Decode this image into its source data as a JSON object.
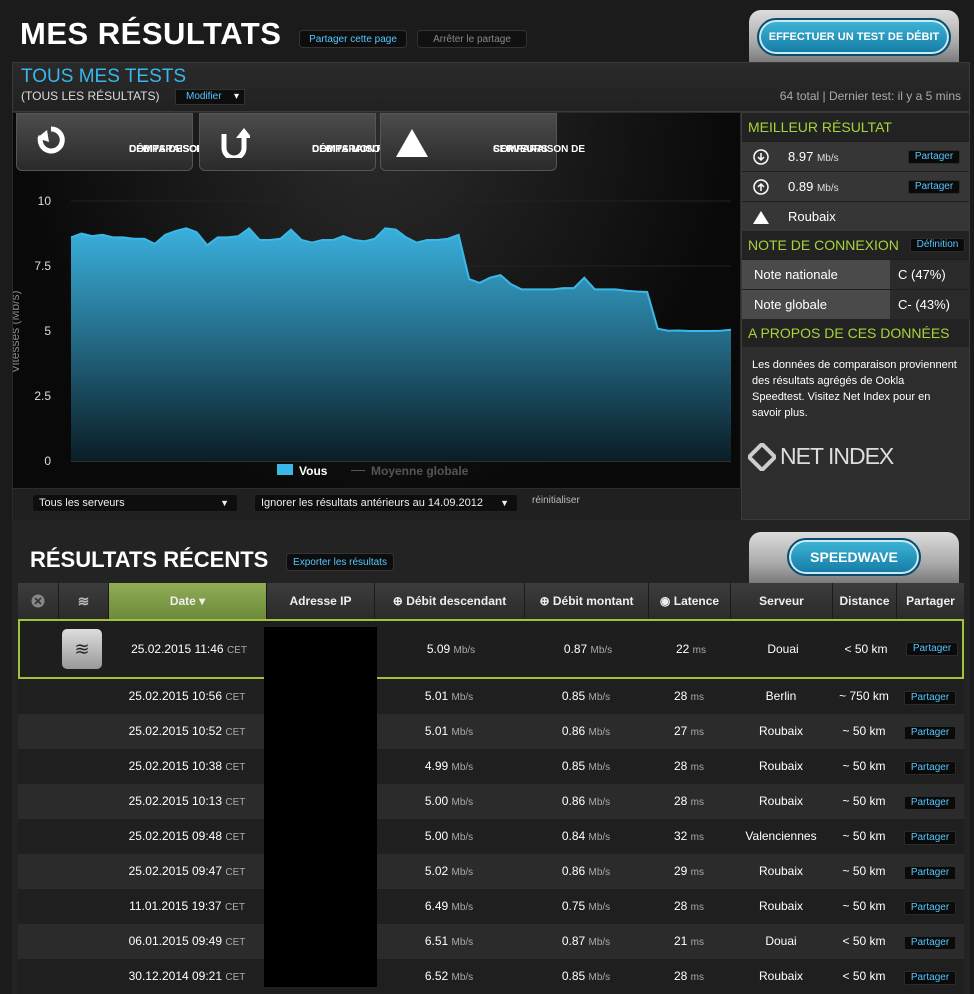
{
  "header": {
    "title": "MES RÉSULTATS",
    "share_page": "Partager cette page",
    "stop_share": "Arrêter le partage",
    "test_button": "EFFECTUER UN TEST DE DÉBIT"
  },
  "panel": {
    "title": "TOUS MES TESTS",
    "subtitle": "(TOUS LES RÉSULTATS)",
    "modify": "Modifier",
    "summary": "64 total | Dernier test: il y a 5 mins"
  },
  "chart_buttons": [
    {
      "line1": "COMPARAISON DE",
      "line2": "DÉBITS DESCENDANTS",
      "icon": "download-arrow-icon"
    },
    {
      "line1": "COMPARAISON DE",
      "line2": "DÉBITS MONTANTS",
      "icon": "upload-arrow-icon"
    },
    {
      "line1": "COMPARAISON DE",
      "line2": "SERVEURS",
      "icon": "triangle-icon"
    }
  ],
  "chart_data": {
    "type": "area",
    "ylabel": "Vitesses (Mb/s)",
    "ylim": [
      0,
      10
    ],
    "yticks": [
      "10",
      "7.5",
      "5",
      "2.5",
      "0"
    ],
    "series": [
      {
        "name": "Vous",
        "color": "#3ab8e8",
        "values": [
          8.6,
          8.75,
          8.65,
          8.7,
          8.6,
          8.6,
          8.55,
          8.55,
          8.35,
          8.7,
          8.85,
          8.95,
          8.8,
          8.3,
          8.6,
          8.6,
          8.65,
          8.95,
          8.5,
          8.5,
          8.55,
          8.9,
          8.5,
          8.4,
          8.5,
          8.5,
          8.65,
          8.5,
          8.45,
          8.55,
          8.95,
          8.9,
          8.6,
          8.4,
          8.5,
          8.5,
          8.55,
          8.7,
          7.0,
          6.85,
          7.05,
          7.15,
          6.8,
          6.6,
          6.6,
          6.6,
          6.6,
          6.65,
          6.65,
          7.05,
          6.6,
          6.6,
          6.6,
          6.55,
          6.52,
          6.5,
          5.09,
          5.01,
          5.02,
          5.0,
          5.0,
          5.0,
          5.01,
          5.05
        ]
      },
      {
        "name": "Moyenne globale",
        "color": "#555"
      }
    ]
  },
  "filters": {
    "servers": "Tous les serveurs",
    "ignore": "Ignorer les résultats antérieurs au 14.09.2012",
    "reset": "réinitialiser"
  },
  "side": {
    "best_title": "MEILLEUR RÉSULTAT",
    "best": [
      {
        "value": "8.97",
        "unit": "Mb/s",
        "share": "Partager",
        "icon": "download-circle-icon"
      },
      {
        "value": "0.89",
        "unit": "Mb/s",
        "share": "Partager",
        "icon": "upload-circle-icon"
      },
      {
        "value": "Roubaix",
        "icon": "triangle-icon"
      }
    ],
    "note_title": "NOTE DE CONNEXION",
    "definition": "Définition",
    "notes": [
      {
        "label": "Note nationale",
        "value": "C (47%)"
      },
      {
        "label": "Note globale",
        "value": "C- (43%)"
      }
    ],
    "about_title": "A PROPOS DE CES DONNÉES",
    "about_text": "Les données de comparaison proviennent des résultats agrégés de Ookla Speedtest. Visitez Net Index pour en savoir plus.",
    "logo": "NET INDEX"
  },
  "recent": {
    "title": "RÉSULTATS RÉCENTS",
    "export": "Exporter les résultats",
    "speedwave": "SPEEDWAVE",
    "columns": [
      "Date ▾",
      "Adresse IP",
      "Débit descendant",
      "Débit montant",
      "Latence",
      "Serveur",
      "Distance",
      "Partager"
    ],
    "rows": [
      {
        "date": "25.02.2015 11:46",
        "tz": "CET",
        "down": "5.09",
        "up": "0.87",
        "lat": "22",
        "server": "Douai",
        "dist": "< 50 km"
      },
      {
        "date": "25.02.2015 10:56",
        "tz": "CET",
        "down": "5.01",
        "up": "0.85",
        "lat": "28",
        "server": "Berlin",
        "dist": "~ 750 km"
      },
      {
        "date": "25.02.2015 10:52",
        "tz": "CET",
        "down": "5.01",
        "up": "0.86",
        "lat": "27",
        "server": "Roubaix",
        "dist": "~ 50 km"
      },
      {
        "date": "25.02.2015 10:38",
        "tz": "CET",
        "down": "4.99",
        "up": "0.85",
        "lat": "28",
        "server": "Roubaix",
        "dist": "~ 50 km"
      },
      {
        "date": "25.02.2015 10:13",
        "tz": "CET",
        "down": "5.00",
        "up": "0.86",
        "lat": "28",
        "server": "Roubaix",
        "dist": "~ 50 km"
      },
      {
        "date": "25.02.2015 09:48",
        "tz": "CET",
        "down": "5.00",
        "up": "0.84",
        "lat": "32",
        "server": "Valenciennes",
        "dist": "~ 50 km"
      },
      {
        "date": "25.02.2015 09:47",
        "tz": "CET",
        "down": "5.02",
        "up": "0.86",
        "lat": "29",
        "server": "Roubaix",
        "dist": "~ 50 km"
      },
      {
        "date": "11.01.2015 19:37",
        "tz": "CET",
        "down": "6.49",
        "up": "0.75",
        "lat": "28",
        "server": "Roubaix",
        "dist": "~ 50 km"
      },
      {
        "date": "06.01.2015 09:49",
        "tz": "CET",
        "down": "6.51",
        "up": "0.87",
        "lat": "21",
        "server": "Douai",
        "dist": "< 50 km"
      },
      {
        "date": "30.12.2014 09:21",
        "tz": "CET",
        "down": "6.52",
        "up": "0.85",
        "lat": "28",
        "server": "Roubaix",
        "dist": "< 50 km"
      }
    ],
    "unit_speed": "Mb/s",
    "unit_ms": "ms",
    "share": "Partager"
  }
}
